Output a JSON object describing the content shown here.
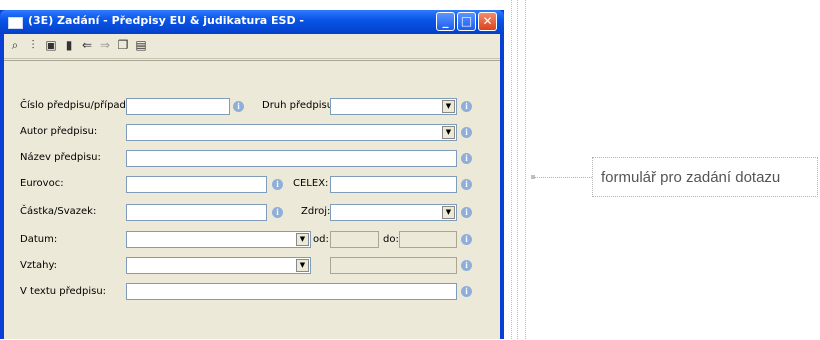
{
  "window": {
    "title": "(3E)  Zadání - Předpisy EU & judikatura ESD -",
    "minimize_glyph": "_",
    "maximize_glyph": "□",
    "close_glyph": "✕"
  },
  "toolbar": {
    "icons": [
      "binoculars-icon",
      "filter-icon",
      "edit-form-icon",
      "trash-icon",
      "back-arrow-icon",
      "forward-arrow-icon",
      "copy-icon",
      "paste-icon"
    ]
  },
  "form": {
    "cislo_label": "Číslo předpisu/případu:",
    "druh_label": "Druh předpisu:",
    "autor_label": "Autor předpisu:",
    "nazev_label": "Název předpisu:",
    "eurovoc_label": "Eurovoc:",
    "celex_label": "CELEX:",
    "castka_label": "Částka/Svazek:",
    "zdroj_label": "Zdroj:",
    "datum_label": "Datum:",
    "od_label": "od:",
    "do_label": "do:",
    "vztahy_label": "Vztahy:",
    "vtextu_label": "V textu předpisu:",
    "info_glyph": "i",
    "dropdown_glyph": "▼"
  },
  "annotation": {
    "text": "formulář pro zadání dotazu"
  }
}
